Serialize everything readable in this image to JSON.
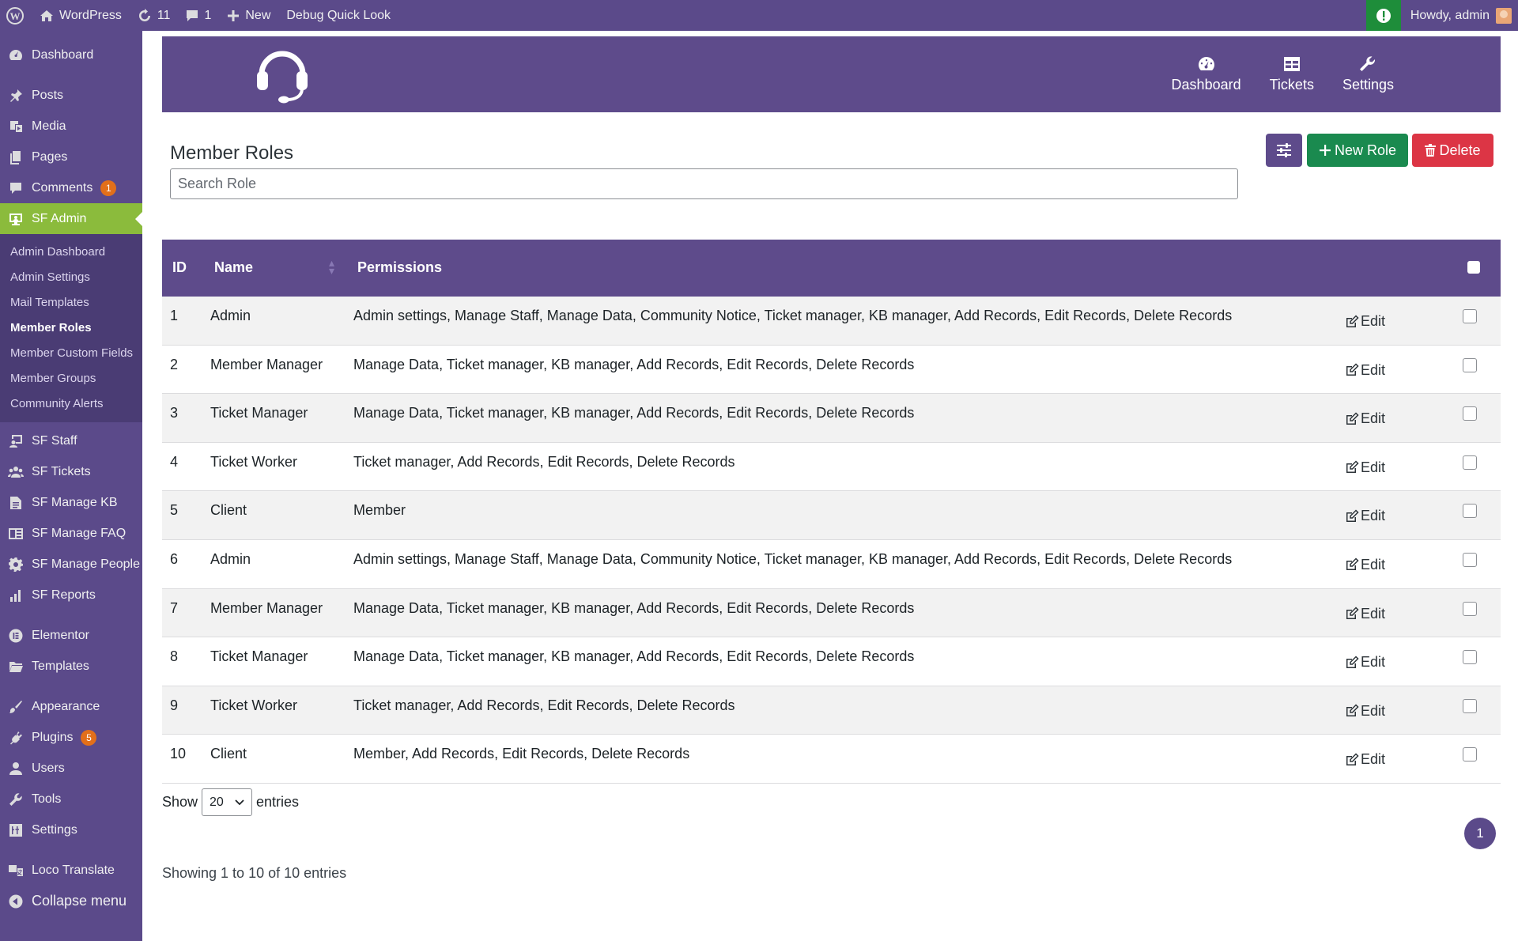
{
  "adminbar": {
    "site": "WordPress",
    "updates": "11",
    "comments": "1",
    "new": "New",
    "debug": "Debug Quick Look",
    "howdy": "Howdy, admin"
  },
  "sidebar": {
    "dashboard": "Dashboard",
    "posts": "Posts",
    "media": "Media",
    "pages": "Pages",
    "comments": "Comments",
    "comments_badge": "1",
    "sf_admin": "SF Admin",
    "sub": [
      "Admin Dashboard",
      "Admin Settings",
      "Mail Templates",
      "Member Roles",
      "Member Custom Fields",
      "Member Groups",
      "Community Alerts"
    ],
    "sf_staff": "SF Staff",
    "sf_tickets": "SF Tickets",
    "sf_manage_kb": "SF Manage KB",
    "sf_manage_faq": "SF Manage FAQ",
    "sf_manage_people": "SF Manage People",
    "sf_reports": "SF Reports",
    "elementor": "Elementor",
    "templates": "Templates",
    "appearance": "Appearance",
    "plugins": "Plugins",
    "plugins_badge": "5",
    "users": "Users",
    "tools": "Tools",
    "settings": "Settings",
    "loco": "Loco Translate",
    "collapse": "Collapse menu"
  },
  "hero": {
    "nav_dashboard": "Dashboard",
    "nav_tickets": "Tickets",
    "nav_settings": "Settings"
  },
  "page": {
    "title": "Member Roles",
    "search_placeholder": "Search Role",
    "new_role": "New Role",
    "delete": "Delete"
  },
  "table": {
    "headers": {
      "id": "ID",
      "name": "Name",
      "permissions": "Permissions"
    },
    "edit_label": "Edit",
    "rows": [
      {
        "id": "1",
        "name": "Admin",
        "permissions": "Admin settings, Manage Staff, Manage Data, Community Notice, Ticket manager, KB manager, Add Records, Edit Records, Delete Records"
      },
      {
        "id": "2",
        "name": "Member Manager",
        "permissions": "Manage Data, Ticket manager, KB manager, Add Records, Edit Records, Delete Records"
      },
      {
        "id": "3",
        "name": "Ticket Manager",
        "permissions": "Manage Data, Ticket manager, KB manager, Add Records, Edit Records, Delete Records"
      },
      {
        "id": "4",
        "name": "Ticket Worker",
        "permissions": "Ticket manager, Add Records, Edit Records, Delete Records"
      },
      {
        "id": "5",
        "name": "Client",
        "permissions": "Member"
      },
      {
        "id": "6",
        "name": "Admin",
        "permissions": "Admin settings, Manage Staff, Manage Data, Community Notice, Ticket manager, KB manager, Add Records, Edit Records, Delete Records"
      },
      {
        "id": "7",
        "name": "Member Manager",
        "permissions": "Manage Data, Ticket manager, KB manager, Add Records, Edit Records, Delete Records"
      },
      {
        "id": "8",
        "name": "Ticket Manager",
        "permissions": "Manage Data, Ticket manager, KB manager, Add Records, Edit Records, Delete Records"
      },
      {
        "id": "9",
        "name": "Ticket Worker",
        "permissions": "Ticket manager, Add Records, Edit Records, Delete Records"
      },
      {
        "id": "10",
        "name": "Client",
        "permissions": "Member, Add Records, Edit Records, Delete Records"
      }
    ]
  },
  "footer": {
    "show": "Show",
    "entries_per_page": "20",
    "entries": "entries",
    "page": "1",
    "info": "Showing 1 to 10 of 10 entries"
  },
  "colors": {
    "brand_purple": "#5e4b8b",
    "active_green": "#8bbb3c",
    "new_btn": "#1a8a4f",
    "delete_btn": "#dc3545"
  }
}
